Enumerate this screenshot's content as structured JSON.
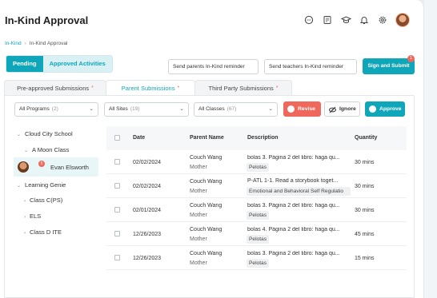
{
  "app": {
    "title": "In-Kind Approval"
  },
  "breadcrumb": {
    "parent": "In-Kind",
    "current": "In-Kind Approval"
  },
  "toolbar": {
    "pending_label": "Pending",
    "approved_label": "Approved Activities",
    "remind_parents_label": "Send parents In-Kind reminder",
    "remind_teachers_label": "Send teachers In-Kind reminder",
    "sign_submit_label": "Sign and Submit",
    "sign_badge": "1"
  },
  "tabs": [
    {
      "label": "Pre-approved Submissions",
      "star": "*"
    },
    {
      "label": "Parent Submissions",
      "star": "*"
    },
    {
      "label": "Third Party Submissions",
      "star": "*"
    }
  ],
  "filters": {
    "programs": {
      "label": "All Programs",
      "count": "(2)"
    },
    "sites": {
      "label": "All Sites",
      "count": "(19)"
    },
    "classes": {
      "label": "All Classes",
      "count": "(67)"
    }
  },
  "actions": {
    "revise": "Revise",
    "ignore": "Ignore",
    "approve": "Approve"
  },
  "tree": {
    "site1": "Cloud City School",
    "class1": "A Moon Class",
    "child": "Evan Elsworth",
    "child_badge": "5",
    "site2": "Learning Genie",
    "class2": "Class C(PS)",
    "class3": "ELS",
    "class4": "Class D ITE"
  },
  "table": {
    "columns": {
      "date": "Date",
      "parent": "Parent Name",
      "description": "Description",
      "quantity": "Quantity"
    },
    "rows": [
      {
        "date": "02/02/2024",
        "parent": "Couch Wang",
        "relation": "Mother",
        "description": "bolas 3. Página 2 del libro: haga qu...",
        "tag": "Pelotas",
        "quantity": "30 mins"
      },
      {
        "date": "02/02/2024",
        "parent": "Couch Wang",
        "relation": "Mother",
        "description": "P-ATL 1-1. Read a storybook toget...",
        "tag": "Emotional and Behavioral Self Regulatio",
        "quantity": "30 mins"
      },
      {
        "date": "02/01/2024",
        "parent": "Couch Wang",
        "relation": "Mother",
        "description": "bolas 3. Página 2 del libro: haga qu...",
        "tag": "Pelotas",
        "quantity": "30 mins"
      },
      {
        "date": "12/26/2023",
        "parent": "Couch Wang",
        "relation": "Mother",
        "description": "bolas 4. Página 2 del libro: haga qu...",
        "tag": "Pelotas",
        "quantity": "45 mins"
      },
      {
        "date": "12/26/2023",
        "parent": "Couch Wang",
        "relation": "Mother",
        "description": "bolas 3. Página 2 del libro: haga qu...",
        "tag": "Pelotas",
        "quantity": "15 mins"
      }
    ]
  },
  "colors": {
    "accent": "#10a6b9",
    "danger": "#f0675c"
  }
}
